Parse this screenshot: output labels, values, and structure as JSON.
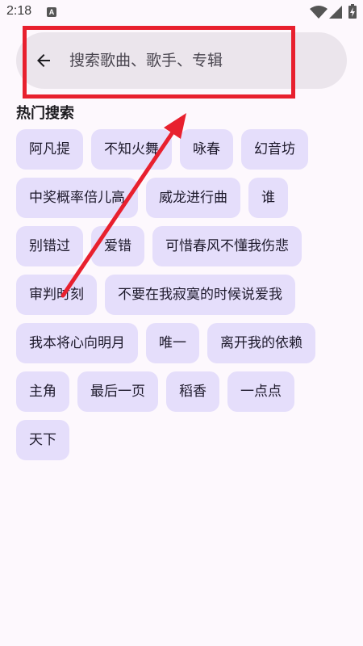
{
  "status_bar": {
    "time": "2:18",
    "notification_badge": "A",
    "icons": [
      "wifi-icon",
      "signal-icon",
      "battery-charging-icon"
    ]
  },
  "search": {
    "placeholder": "搜索歌曲、歌手、专辑",
    "back_icon": "arrow-left-icon"
  },
  "hot_search": {
    "title": "热门搜索",
    "tags": [
      "阿凡提",
      "不知火舞",
      "咏春",
      "幻音坊",
      "中奖概率倍儿高",
      "威龙进行曲",
      "谁",
      "别错过",
      "爱错",
      "可惜春风不懂我伤悲",
      "审判时刻",
      "不要在我寂寞的时候说爱我",
      "我本将心向明月",
      "唯一",
      "离开我的依赖",
      "主角",
      "最后一页",
      "稻香",
      "一点点",
      "天下"
    ]
  },
  "colors": {
    "background": "#fdf8fd",
    "search_bar": "#ebe5ec",
    "tag_background": "#e5defb",
    "annotation": "#e8202e"
  }
}
